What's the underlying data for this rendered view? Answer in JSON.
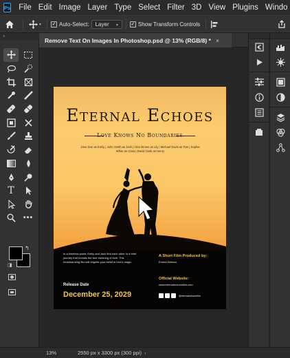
{
  "menu": {
    "app_icon": "Ps",
    "items": [
      "File",
      "Edit",
      "Image",
      "Layer",
      "Type",
      "Select",
      "Filter",
      "3D",
      "View",
      "Plugins",
      "Windo"
    ]
  },
  "options": {
    "auto_select_label": "Auto-Select:",
    "auto_select_value": "Layer",
    "transform_label": "Show Transform Controls"
  },
  "document": {
    "tab_title": "Remove Text On Images In Photoshop.psd @ 13% (RGB/8) *",
    "close": "×"
  },
  "poster": {
    "title": "Eternal Echoes",
    "subtitle": "Love Knows No Boundaries",
    "credits": "Jane Doe as Emily | John Smith as Jack | Alice Brown as Lily | Michael Davis as Tom | Sophie White as Clara | David Clark as Henry",
    "story": "In a timeless world, Emily and Jack find each other in a brief journey that reveals the true meaning of love. This heartwarming film will reignite your belief in love's magic.",
    "release_label": "Release Date",
    "release_date": "December 25, 2029",
    "produced_heading": "A Short Film Produced by:",
    "producer": "Emma Watson",
    "website_heading": "Official Website:",
    "website": "www.eternalechoesfilm.com",
    "handle": "@eternalechoesfilm"
  },
  "status": {
    "zoom": "13%",
    "info": "2550 px x 3300 px (300 ppi)",
    "arrow": "›"
  },
  "colors": {
    "accent_gold": "#f2c64a",
    "ps_blue": "#31a8ff",
    "panel": "#323232",
    "canvas": "#272727"
  }
}
